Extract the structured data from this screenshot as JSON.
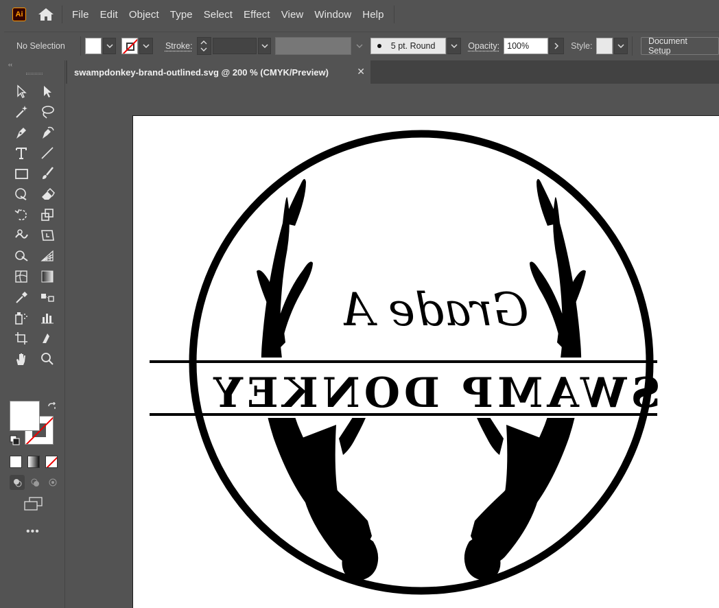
{
  "app": {
    "logo_text": "Ai"
  },
  "menu": [
    "File",
    "Edit",
    "Object",
    "Type",
    "Select",
    "Effect",
    "View",
    "Window",
    "Help"
  ],
  "control_bar": {
    "selection_status": "No Selection",
    "stroke_label": "Stroke:",
    "brush_value": "5 pt. Round",
    "opacity_label": "Opacity:",
    "opacity_value": "100%",
    "style_label": "Style:",
    "document_setup_label": "Document Setup"
  },
  "document_tab": {
    "title": "swampdonkey-brand-outlined.svg @ 200 % (CMYK/Preview)",
    "close_glyph": "✕"
  },
  "toolbar": {
    "collapse_glyph": "‹‹",
    "more_glyph": "•••",
    "tools": [
      "selection-tool",
      "direct-selection-tool",
      "magic-wand-tool",
      "lasso-tool",
      "pen-tool",
      "curvature-tool",
      "type-tool",
      "line-segment-tool",
      "rectangle-tool",
      "paintbrush-tool",
      "shaper-tool",
      "eraser-tool",
      "rotate-tool",
      "scale-tool",
      "warp-tool",
      "free-transform-tool",
      "shape-builder-tool",
      "perspective-grid-tool",
      "mesh-tool",
      "gradient-tool",
      "eyedropper-tool",
      "blend-tool",
      "symbol-sprayer-tool",
      "column-graph-tool",
      "artboard-tool",
      "slice-tool",
      "hand-tool",
      "zoom-tool"
    ]
  },
  "artwork": {
    "script_text": "Grade A",
    "banner_text": "SWAMP DONKEY",
    "mirrored": true
  },
  "colors": {
    "accent": "#ff9a00",
    "ui_bg": "#535353",
    "artboard": "#ffffff",
    "art_ink": "#000000"
  }
}
